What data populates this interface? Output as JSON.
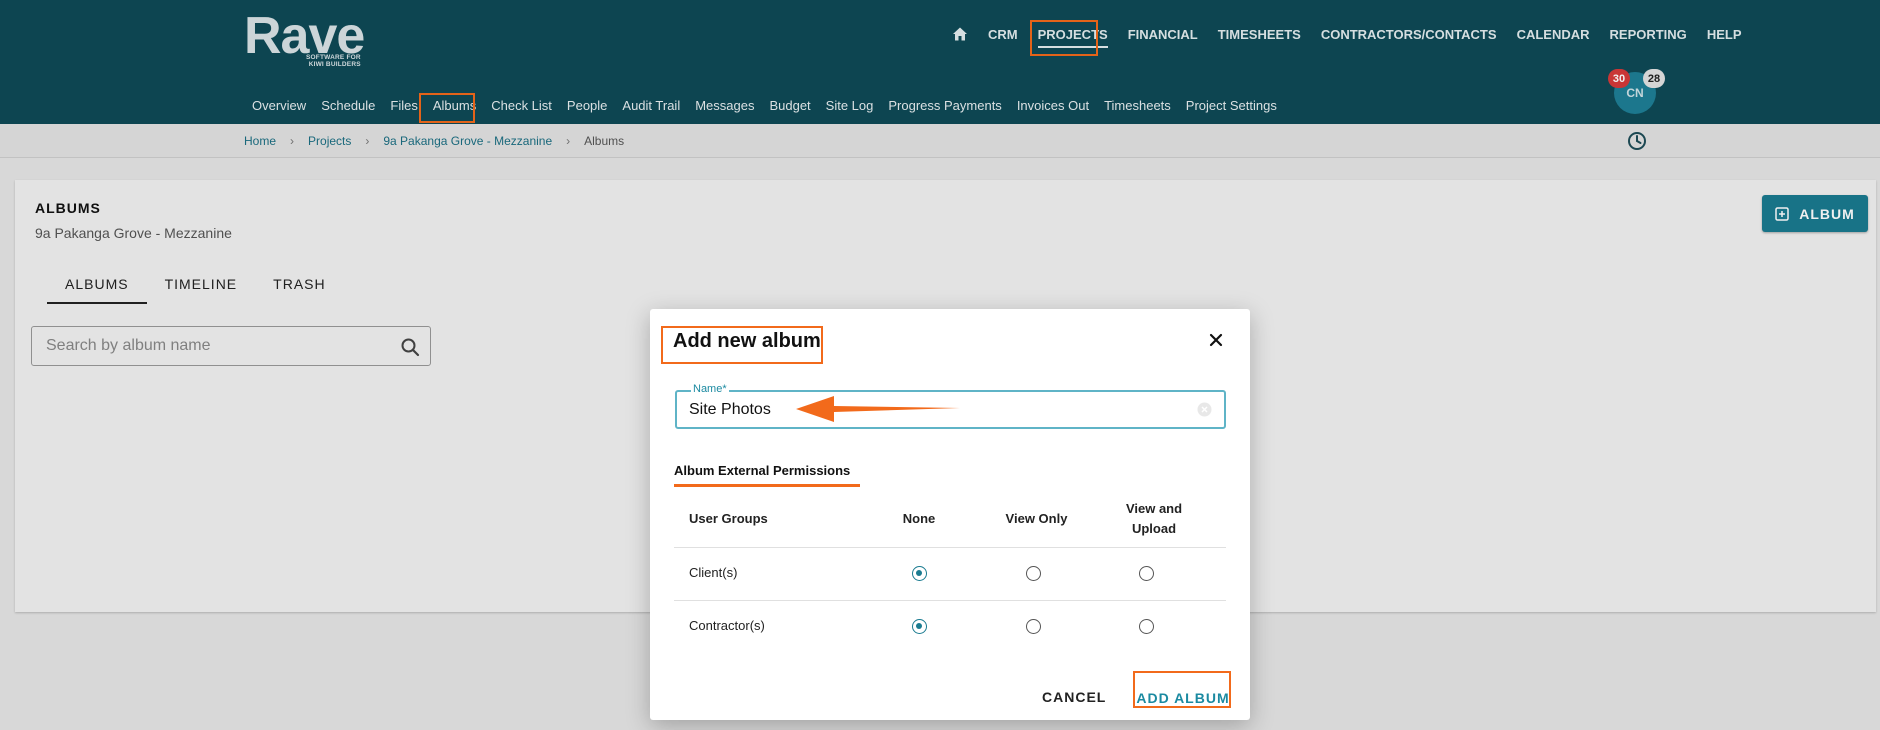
{
  "logo": {
    "word": "Rave",
    "tagline_1": "SOFTWARE FOR",
    "tagline_2": "KIWI BUILDERS"
  },
  "main_nav": [
    "CRM",
    "PROJECTS",
    "FINANCIAL",
    "TIMESHEETS",
    "CONTRACTORS/CONTACTS",
    "CALENDAR",
    "REPORTING",
    "HELP"
  ],
  "main_nav_active": "PROJECTS",
  "sub_nav": [
    "Overview",
    "Schedule",
    "Files",
    "Albums",
    "Check List",
    "People",
    "Audit Trail",
    "Messages",
    "Budget",
    "Site Log",
    "Progress Payments",
    "Invoices Out",
    "Timesheets",
    "Project Settings"
  ],
  "sub_nav_active": "Albums",
  "user": {
    "initials": "CN",
    "badge_red": "30",
    "badge_grey": "28"
  },
  "breadcrumb": [
    "Home",
    "Projects",
    "9a Pakanga Grove - Mezzanine",
    "Albums"
  ],
  "page": {
    "title": "ALBUMS",
    "subtitle": "9a Pakanga Grove - Mezzanine",
    "tabs": [
      "ALBUMS",
      "TIMELINE",
      "TRASH"
    ],
    "active_tab": "ALBUMS",
    "search_placeholder": "Search by album name",
    "add_button": "ALBUM"
  },
  "modal": {
    "title": "Add new album",
    "name_label": "Name*",
    "name_value": "Site Photos",
    "permissions_title": "Album External Permissions",
    "columns": [
      "User Groups",
      "None",
      "View Only",
      "View and Upload"
    ],
    "column_4_line1": "View and",
    "column_4_line2": "Upload",
    "rows": [
      {
        "group": "Client(s)",
        "selected": "None"
      },
      {
        "group": "Contractor(s)",
        "selected": "None"
      }
    ],
    "cancel": "CANCEL",
    "submit": "ADD ALBUM"
  },
  "colors": {
    "header": "#0e4a57",
    "accent": "#1a7b90",
    "highlight": "#f26a1b"
  }
}
